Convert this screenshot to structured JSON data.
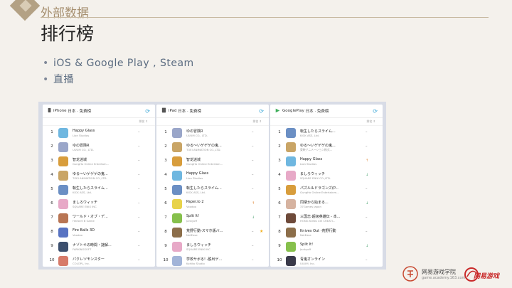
{
  "header": {
    "section": "外部数据",
    "title": "排行榜"
  },
  "bullets": [
    "iOS & Google Play , Steam",
    "直播"
  ],
  "panels": [
    {
      "device": "iPhone",
      "subtitle": "日本 · 免费榜",
      "sort_label": "排名 ⇕",
      "rows": [
        {
          "rank": "1",
          "name": "Happy Glass",
          "dev": "Lion Studios",
          "trend": "–",
          "color": "#6fb7e0"
        },
        {
          "rank": "2",
          "name": "ゆの冒険R",
          "dev": "UUUM CO., LTD.",
          "trend": "–",
          "color": "#9aa6c9"
        },
        {
          "rank": "3",
          "name": "智龙迷城",
          "dev": "GungHo Online Entertain...",
          "trend": "–",
          "color": "#d89d3c"
        },
        {
          "rank": "4",
          "name": "ゆる～いゲゲゲの鬼...",
          "dev": "TOEI ANIMATION CO.,LTD.",
          "trend": "–",
          "color": "#c9a566"
        },
        {
          "rank": "5",
          "name": "転生したらスライム...",
          "dev": "KICK ASS, Ltd.",
          "trend": "–",
          "color": "#6b8fc4"
        },
        {
          "rank": "6",
          "name": "ましろウィッチ",
          "dev": "SQUARE ENIX INC",
          "trend": "–",
          "color": "#e7a9c7"
        },
        {
          "rank": "7",
          "name": "ワールド・オブ・デ...",
          "dev": "Herbert B Game",
          "trend": "–",
          "color": "#b87554"
        },
        {
          "rank": "8",
          "name": "Fire Balls 3D",
          "dev": "Voodoo",
          "trend": "–",
          "color": "#5873c2"
        },
        {
          "rank": "9",
          "name": "ナゾトキの時間・謎解...",
          "dev": "FARKINGSOFT",
          "trend": "–",
          "color": "#3c4f6e"
        },
        {
          "rank": "10",
          "name": "パクレツモンスター",
          "dev": "COLOPL, Inc.",
          "trend": "–",
          "color": "#d77b6a"
        }
      ]
    },
    {
      "device": "iPad",
      "subtitle": "日本 · 免费榜",
      "sort_label": "排名 ⇕",
      "rows": [
        {
          "rank": "1",
          "name": "ゆの冒険R",
          "dev": "UUUM CO., LTD.",
          "trend": "–",
          "color": "#9aa6c9"
        },
        {
          "rank": "2",
          "name": "ゆる～いゲゲゲの鬼...",
          "dev": "TOEI ANIMATION CO.,LTD.",
          "trend": "–",
          "color": "#c9a566"
        },
        {
          "rank": "3",
          "name": "智龙迷城",
          "dev": "GungHo Online Entertain...",
          "trend": "–",
          "color": "#d89d3c"
        },
        {
          "rank": "4",
          "name": "Happy Glass",
          "dev": "Lion Studios",
          "trend": "–",
          "color": "#6fb7e0"
        },
        {
          "rank": "5",
          "name": "転生したらスライム...",
          "dev": "KICK ASS, Ltd.",
          "trend": "–",
          "color": "#6b8fc4"
        },
        {
          "rank": "6",
          "name": "Paper.io 2",
          "dev": "Voodoo",
          "trend": "↑",
          "color": "#e8d34a"
        },
        {
          "rank": "7",
          "name": "Split It!",
          "dev": "Jankyoff",
          "trend": "↓",
          "color": "#86c04c"
        },
        {
          "rank": "8",
          "name": "荒野行動-スマホ版バ...",
          "dev": "NetEase",
          "trend": "–",
          "color": "#8c6e4a",
          "badge": "★"
        },
        {
          "rank": "9",
          "name": "ましろウィッチ",
          "dev": "SQUARE ENIX INC",
          "trend": "–",
          "color": "#e7a9c7"
        },
        {
          "rank": "10",
          "name": "学校サボる!  -脱出ゲ...",
          "dev": "Kohiko Studio",
          "trend": "–",
          "color": "#a2b4d8"
        }
      ]
    },
    {
      "device": "GooglePlay",
      "subtitle": "日本 · 免费榜",
      "sort_label": "排名 ⇕",
      "rows": [
        {
          "rank": "1",
          "name": "転生したらスライム...",
          "dev": "KICK ASS, Ltd.",
          "trend": "–",
          "color": "#6b8fc4"
        },
        {
          "rank": "2",
          "name": "ゆる～いゲゲゲの鬼...",
          "dev": "東映アニメーション株式...",
          "trend": "–",
          "color": "#c9a566"
        },
        {
          "rank": "3",
          "name": "Happy Glass",
          "dev": "Lion Studios",
          "trend": "↑",
          "color": "#6fb7e0"
        },
        {
          "rank": "4",
          "name": "ましろウィッチ",
          "dev": "SQUARE ENIX CO.,LTD.",
          "trend": "↓",
          "color": "#e7a9c7"
        },
        {
          "rank": "5",
          "name": "パズル＆ドラゴンズ(P...",
          "dev": "GungHo Online Entertainm...",
          "trend": "–",
          "color": "#d89d3c"
        },
        {
          "rank": "6",
          "name": "同棲から始まる...",
          "dev": "37Games japan",
          "trend": "↓",
          "color": "#d6b3a0"
        },
        {
          "rank": "7",
          "name": "三国志·超级英雄伝 - 本...",
          "dev": "HONG KONG XIE CREATI...",
          "trend": "–",
          "color": "#6e4a3a"
        },
        {
          "rank": "8",
          "name": "Knives Out -荒野行動",
          "dev": "NetEase",
          "trend": "–",
          "color": "#8c6e4a"
        },
        {
          "rank": "9",
          "name": "Split It!",
          "dev": "Jankyoff",
          "trend": "↓",
          "color": "#86c04c"
        },
        {
          "rank": "10",
          "name": "青鬼オンライン",
          "dev": "UUUM, Inc.",
          "trend": "–",
          "color": "#3a3a4a"
        }
      ]
    }
  ],
  "footer": {
    "academy_name": "网易游戏学院",
    "academy_url": "game.academy.163.com",
    "netease_logo": "网易游戏"
  }
}
